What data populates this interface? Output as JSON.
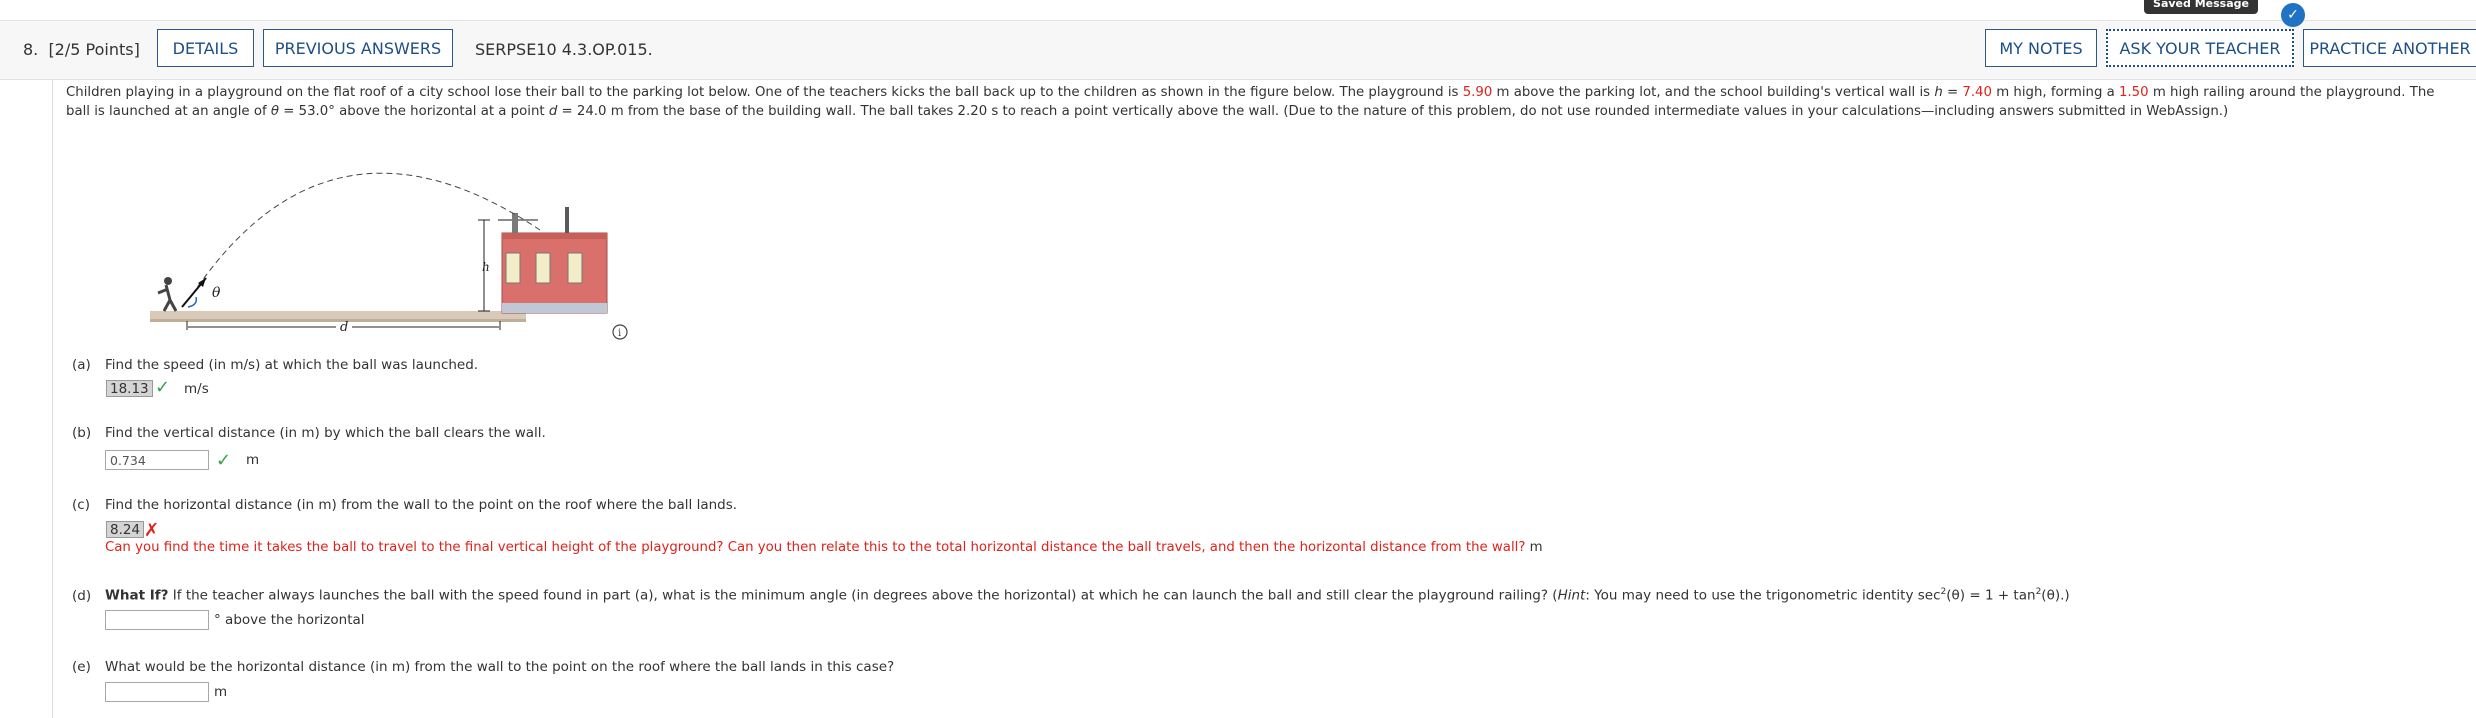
{
  "tooltip": "Saved Message",
  "header": {
    "question_number": "8.",
    "points": "[2/5 Points]",
    "details_label": "DETAILS",
    "previous_answers_label": "PREVIOUS ANSWERS",
    "code": "SERPSE10 4.3.OP.015.",
    "my_notes_label": "MY NOTES",
    "ask_teacher_label": "ASK YOUR TEACHER",
    "practice_label": "PRACTICE ANOTHER"
  },
  "problem": {
    "s1": "Children playing in a playground on the flat roof of a city school lose their ball to the parking lot below. One of the teachers kicks the ball back up to the children as shown in the figure below. The playground is ",
    "height_playground": "5.90",
    "s2": " m above the parking lot, and the school building's vertical wall is ",
    "h_var": "h",
    "s3": " = ",
    "h_value": "7.40",
    "s4": " m high, forming a ",
    "railing": "1.50",
    "s5": " m high railing around the playground. The ball is launched at an angle of ",
    "theta": "θ",
    "s6": " = 53.0° above the horizontal at a point ",
    "d_var": "d",
    "s7": " = 24.0 m from the base of the building wall. The ball takes 2.20 s to reach a point vertically above the wall. (Due to the nature of this problem, do not use rounded intermediate values in your calculations—including answers submitted in WebAssign.)"
  },
  "figure": {
    "label_theta": "θ",
    "label_d": "d",
    "label_h": "h",
    "info_icon": "i"
  },
  "parts": {
    "a": {
      "label": "(a)",
      "question": "Find the speed (in m/s) at which the ball was launched.",
      "answer": "18.13",
      "unit": "m/s"
    },
    "b": {
      "label": "(b)",
      "question": "Find the vertical distance (in m) by which the ball clears the wall.",
      "answer": "0.734",
      "unit": "m"
    },
    "c": {
      "label": "(c)",
      "question": "Find the horizontal distance (in m) from the wall to the point on the roof where the ball lands.",
      "answer": "8.24",
      "hint": "Can you find the time it takes the ball to travel to the final vertical height of the playground? Can you then relate this to the total horizontal distance the ball travels, and then the horizontal distance from the wall?",
      "unit": "m"
    },
    "d": {
      "label": "(d)",
      "bold": "What If?",
      "question": " If the teacher always launches the ball with the speed found in part (a), what is the minimum angle (in degrees above the horizontal) at which he can launch the ball and still clear the playground railing? (",
      "hint_word": "Hint",
      "q2": ": You may need to use the trigonometric identity sec",
      "q3": "(θ) = 1 + tan",
      "q4": "(θ).)",
      "sup": "2",
      "answer": "",
      "unit": "° above the horizontal"
    },
    "e": {
      "label": "(e)",
      "question": "What would be the horizontal distance (in m) from the wall to the point on the roof where the ball lands in this case?",
      "answer": "",
      "unit": "m"
    }
  },
  "colors": {
    "accent": "#1c4f86",
    "highlight": "#e0221b",
    "correct": "#35a34a"
  }
}
